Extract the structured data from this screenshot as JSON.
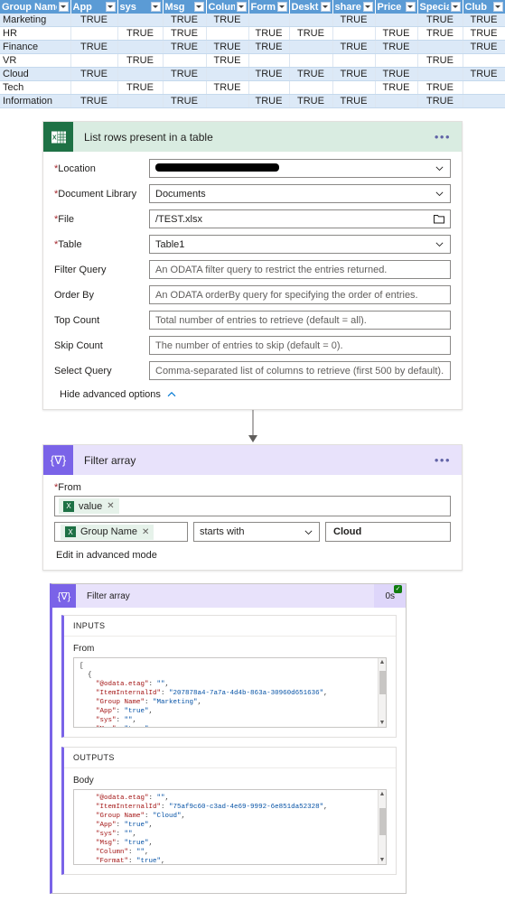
{
  "spreadsheet": {
    "columns": [
      "Group Name",
      "App",
      "sys",
      "Msg",
      "Column",
      "Format",
      "Desktop",
      "shared",
      "Price",
      "Special",
      "Club"
    ],
    "true_text": "TRUE",
    "rows": [
      {
        "name": "Marketing",
        "flags": [
          "TRUE",
          "",
          "TRUE",
          "TRUE",
          "",
          "",
          "TRUE",
          "",
          "TRUE",
          "TRUE"
        ]
      },
      {
        "name": "HR",
        "flags": [
          "",
          "TRUE",
          "TRUE",
          "",
          "TRUE",
          "TRUE",
          "",
          "TRUE",
          "TRUE",
          "TRUE"
        ]
      },
      {
        "name": "Finance",
        "flags": [
          "TRUE",
          "",
          "TRUE",
          "TRUE",
          "TRUE",
          "",
          "TRUE",
          "TRUE",
          "",
          "TRUE"
        ]
      },
      {
        "name": "VR",
        "flags": [
          "",
          "TRUE",
          "",
          "TRUE",
          "",
          "",
          "",
          "",
          "TRUE",
          ""
        ]
      },
      {
        "name": "Cloud",
        "flags": [
          "TRUE",
          "",
          "TRUE",
          "",
          "TRUE",
          "TRUE",
          "TRUE",
          "TRUE",
          "",
          "TRUE"
        ]
      },
      {
        "name": "Tech",
        "flags": [
          "",
          "TRUE",
          "",
          "TRUE",
          "",
          "",
          "",
          "TRUE",
          "TRUE",
          ""
        ]
      },
      {
        "name": "Information",
        "flags": [
          "TRUE",
          "",
          "TRUE",
          "",
          "TRUE",
          "TRUE",
          "TRUE",
          "",
          "TRUE",
          ""
        ]
      }
    ]
  },
  "list_rows_card": {
    "title": "List rows present in a table",
    "icon": "excel-icon",
    "menu": "•••",
    "fields": [
      {
        "label": "Location",
        "required": true,
        "value": "",
        "placeholder": "",
        "redacted": true,
        "control": "chevron-down-icon"
      },
      {
        "label": "Document Library",
        "required": true,
        "value": "Documents",
        "placeholder": "",
        "redacted": false,
        "control": "chevron-down-icon"
      },
      {
        "label": "File",
        "required": true,
        "value": "/TEST.xlsx",
        "placeholder": "",
        "redacted": false,
        "control": "folder-icon"
      },
      {
        "label": "Table",
        "required": true,
        "value": "Table1",
        "placeholder": "",
        "redacted": false,
        "control": "chevron-down-icon"
      },
      {
        "label": "Filter Query",
        "required": false,
        "value": "",
        "placeholder": "An ODATA filter query to restrict the entries returned.",
        "redacted": false,
        "control": "none"
      },
      {
        "label": "Order By",
        "required": false,
        "value": "",
        "placeholder": "An ODATA orderBy query for specifying the order of entries.",
        "redacted": false,
        "control": "none"
      },
      {
        "label": "Top Count",
        "required": false,
        "value": "",
        "placeholder": "Total number of entries to retrieve (default = all).",
        "redacted": false,
        "control": "none"
      },
      {
        "label": "Skip Count",
        "required": false,
        "value": "",
        "placeholder": "The number of entries to skip (default = 0).",
        "redacted": false,
        "control": "none"
      },
      {
        "label": "Select Query",
        "required": false,
        "value": "",
        "placeholder": "Comma-separated list of columns to retrieve (first 500 by default).",
        "redacted": false,
        "control": "none"
      }
    ],
    "advanced_toggle": "Hide advanced options"
  },
  "filter_array_card": {
    "title": "Filter array",
    "icon": "filter-array-icon",
    "menu": "•••",
    "from_label": "From",
    "from_token": "value",
    "token_remove": "✕",
    "condition": {
      "left_token": "Group Name",
      "operator": "starts with",
      "value": "Cloud"
    },
    "advanced_link": "Edit in advanced mode"
  },
  "run_history": {
    "title": "Filter array",
    "duration": "0s",
    "status": "succeeded",
    "inputs": {
      "heading": "INPUTS",
      "sub_label": "From",
      "json_lines": [
        "[",
        "  {",
        "    \"@odata.etag\": \"\",",
        "    \"ItemInternalId\": \"207878a4-7a7a-4d4b-863a-30960d651636\",",
        "    \"Group Name\": \"Marketing\",",
        "    \"App\": \"true\",",
        "    \"sys\": \"\",",
        "    \"Msg\": \"true\","
      ]
    },
    "outputs": {
      "heading": "OUTPUTS",
      "sub_label": "Body",
      "json_lines": [
        "    \"@odata.etag\": \"\",",
        "    \"ItemInternalId\": \"75af9c60-c3ad-4e69-9992-6e851da52328\",",
        "    \"Group Name\": \"Cloud\",",
        "    \"App\": \"true\",",
        "    \"sys\": \"\",",
        "    \"Msg\": \"true\",",
        "    \"Column\": \"\",",
        "    \"Format\": \"true\","
      ]
    }
  },
  "colors": {
    "excel_green": "#1e7145",
    "excel_header_bg": "#d9ece1",
    "flow_purple": "#7a63e8",
    "filter_header_bg": "#e8e2fb",
    "table_header_blue": "#5b9bd5",
    "table_band": "#dce9f7",
    "required_red": "#a4262c",
    "success_green": "#107c10"
  }
}
